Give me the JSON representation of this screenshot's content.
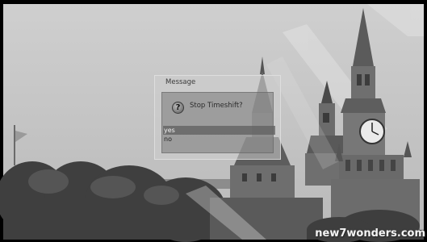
{
  "dialog": {
    "title": "Message",
    "question_icon": "question-mark-icon",
    "question_glyph": "?",
    "question": "Stop Timeshift?",
    "options": [
      {
        "label": "yes",
        "selected": true
      },
      {
        "label": "no",
        "selected": false
      }
    ]
  },
  "watermark": "new7wonders.com"
}
